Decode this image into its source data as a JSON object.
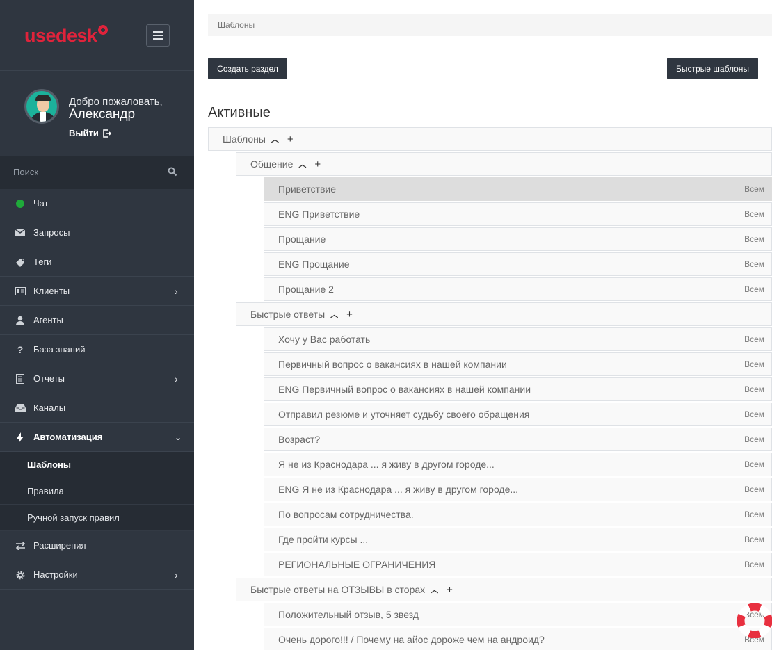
{
  "brand": {
    "logo_text": "usedesk",
    "accent": "#e0233b"
  },
  "profile": {
    "welcome": "Добро пожаловать,",
    "name": "Александр",
    "logout_label": "Выйти"
  },
  "search": {
    "placeholder": "Поиск"
  },
  "nav": [
    {
      "label": "Чат",
      "icon": "status-dot-icon"
    },
    {
      "label": "Запросы",
      "icon": "envelope-icon"
    },
    {
      "label": "Теги",
      "icon": "tag-icon"
    },
    {
      "label": "Клиенты",
      "icon": "id-card-icon"
    },
    {
      "label": "Агенты",
      "icon": "user-icon"
    },
    {
      "label": "База знаний",
      "icon": "question-icon"
    },
    {
      "label": "Отчеты",
      "icon": "document-icon"
    },
    {
      "label": "Каналы",
      "icon": "inbox-icon"
    },
    {
      "label": "Автоматизация",
      "icon": "bolt-icon"
    },
    {
      "label": "Расширения",
      "icon": "exchange-icon"
    },
    {
      "label": "Настройки",
      "icon": "gear-icon"
    }
  ],
  "subnav": [
    {
      "label": "Шаблоны"
    },
    {
      "label": "Правила"
    },
    {
      "label": "Ручной запуск правил"
    }
  ],
  "breadcrumb": "Шаблоны",
  "buttons": {
    "create": "Создать раздел",
    "quick": "Быстрые шаблоны"
  },
  "section_title": "Активные",
  "tree": {
    "root": "Шаблоны",
    "groups": [
      {
        "name": "Общение",
        "items": [
          {
            "title": "Приветствие",
            "access": "Всем"
          },
          {
            "title": "ENG Приветствие",
            "access": "Всем"
          },
          {
            "title": "Прощание",
            "access": "Всем"
          },
          {
            "title": "ENG Прощание",
            "access": "Всем"
          },
          {
            "title": "Прощание 2",
            "access": "Всем"
          }
        ]
      },
      {
        "name": "Быстрые ответы",
        "items": [
          {
            "title": "Хочу у Вас работать",
            "access": "Всем"
          },
          {
            "title": "Первичный вопрос о вакансиях в нашей компании",
            "access": "Всем"
          },
          {
            "title": "ENG Первичный вопрос о вакансиях в нашей компании",
            "access": "Всем"
          },
          {
            "title": "Отправил резюме и уточняет судьбу своего обращения",
            "access": "Всем"
          },
          {
            "title": "Возраст?",
            "access": "Всем"
          },
          {
            "title": "Я не из Краснодара ... я живу в другом городе...",
            "access": "Всем"
          },
          {
            "title": "ENG Я не из Краснодара ... я живу в другом городе...",
            "access": "Всем"
          },
          {
            "title": "По вопросам сотрудничества.",
            "access": "Всем"
          },
          {
            "title": "Где пройти курсы ...",
            "access": "Всем"
          },
          {
            "title": "РЕГИОНАЛЬНЫЕ ОГРАНИЧЕНИЯ",
            "access": "Всем"
          }
        ]
      },
      {
        "name": "Быстрые ответы на ОТЗЫВЫ в сторах",
        "items": [
          {
            "title": "Положительный отзыв, 5 звезд",
            "access": "Всем"
          },
          {
            "title": "Очень дорого!!! / Почему на айос дороже чем на андроид?",
            "access": "Всем"
          }
        ]
      }
    ]
  }
}
